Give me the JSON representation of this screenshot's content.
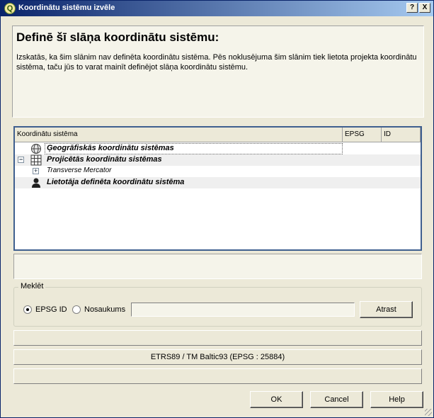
{
  "window": {
    "title": "Koordinātu sistēmu izvēle",
    "help_btn": "?",
    "close_btn": "X"
  },
  "header": {
    "title": "Definē šī slāņa koordinātu sistēmu:",
    "description": "Izskatās, ka šim slānim nav definēta koordinātu sistēma. Pēs noklusējuma šim slānim tiek lietota projekta koordinātu sistēma, taču jūs to varat mainīt definējot slāņa koordinātu sistēmu."
  },
  "tree": {
    "columns": [
      "Koordinātu sistēma",
      "EPSG",
      "ID"
    ],
    "rows": [
      {
        "label": "Ģeogrāfiskās koordinātu sistēmas",
        "icon": "globe-icon"
      },
      {
        "label": "Projicētās koordinātu sistēmas",
        "icon": "grid-icon"
      },
      {
        "label": "Transverse Mercator",
        "icon": ""
      },
      {
        "label": "Lietotāja definēta koordinātu sistēma",
        "icon": "user-icon"
      }
    ]
  },
  "search": {
    "group_label": "Meklēt",
    "option_epsg": "EPSG ID",
    "option_name": "Nosaukums",
    "query": "",
    "find_button": "Atrast"
  },
  "recent": {
    "item": "ETRS89 / TM Baltic93 (EPSG : 25884)"
  },
  "footer": {
    "ok": "OK",
    "cancel": "Cancel",
    "help": "Help"
  },
  "colors": {
    "title_gradient_start": "#0a246a",
    "title_gradient_end": "#a6caf0",
    "dialog_bg": "#ece9d8"
  }
}
